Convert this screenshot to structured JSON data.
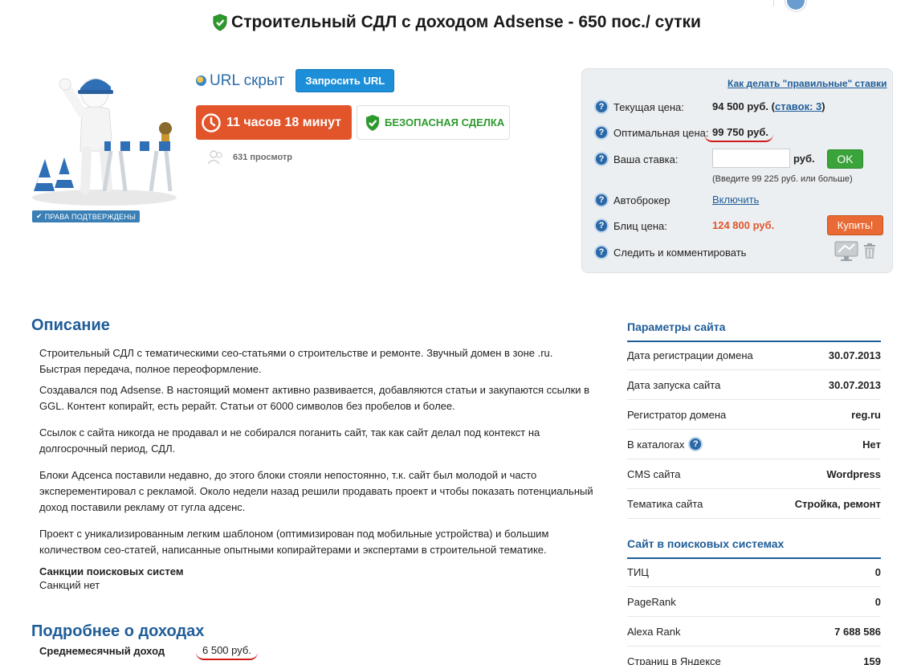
{
  "title": "Строительный СДЛ с доходом Adsense - 650 пос./ сутки",
  "rights_badge": "ПРАВА ПОДТВЕРЖДЕНЫ",
  "url_hidden": "URL скрыт",
  "request_url_button": "Запросить URL",
  "timer": "11 часов 18 минут",
  "safe_deal": "БЕЗОПАСНАЯ СДЕЛКА",
  "views": "631 просмотр",
  "bid": {
    "how_link": "Как делать \"правильные\" ставки",
    "current_label": "Текущая цена:",
    "current_value": "94 500 руб.",
    "current_bids_prefix": "(",
    "current_bids_link": "ставок: 3",
    "current_bids_suffix": ")",
    "optimal_label": "Оптимальная цена:",
    "optimal_value": "99 750 руб.",
    "your_bid_label": "Ваша ставка:",
    "your_bid_value": "",
    "rub": "руб.",
    "ok": "OK",
    "hint": "(Введите 99 225 руб. или больше)",
    "autobroker_label": "Автоброкер",
    "autobroker_link": "Включить",
    "blitz_label": "Блиц цена:",
    "blitz_value": "124 800 руб.",
    "buy": "Купить!",
    "follow_label": "Следить и комментировать"
  },
  "description": {
    "heading": "Описание",
    "p1": "Строительный СДЛ с тематическими сео-статьями о строительстве и ремонте. Звучный домен в зоне .ru. Быстрая передача, полное переоформление.",
    "p2": "Создавался под Adsense. В настоящий момент активно развивается, добавляются статьи и закупаются ссылки в GGL. Контент копирайт, есть рерайт. Статьи от 6000 символов без пробелов и более.",
    "p3": "Ссылок с сайта никогда не продавал и не собирался поганить сайт, так как сайт делал под контекст на долгосрочный период, СДЛ.",
    "p4": "Блоки Адсенса поставили недавно, до этого блоки стояли непостоянно, т.к. сайт был молодой и часто эксперементировал с рекламой. Около недели назад решили продавать проект и чтобы показать потенциальный доход поставили рекламу от гугла адсенс.",
    "p5": "Проект с уникализированным легким шаблоном (оптимизирован под мобильные устройства) и большим количеством сео-статей, написанные опытными копирайтерами и экспертами в строительной тематике.",
    "sanctions_label": "Санкции поисковых систем",
    "sanctions_value": "Санкций нет"
  },
  "income": {
    "heading": "Подробнее о доходах",
    "monthly_label": "Среднемесячный доход",
    "monthly_value": "6 500 руб."
  },
  "site_params": {
    "heading": "Параметры сайта",
    "rows": [
      {
        "label": "Дата регистрации домена",
        "value": "30.07.2013"
      },
      {
        "label": "Дата запуска сайта",
        "value": "30.07.2013"
      },
      {
        "label": "Регистратор домена",
        "value": "reg.ru"
      },
      {
        "label": "В каталогах",
        "value": "Нет"
      },
      {
        "label": "CMS сайта",
        "value": "Wordpress"
      },
      {
        "label": "Тематика сайта",
        "value": "Стройка, ремонт"
      }
    ]
  },
  "search_engines": {
    "heading": "Сайт в поисковых системах",
    "rows": [
      {
        "label": "ТИЦ",
        "value": "0"
      },
      {
        "label": "PageRank",
        "value": "0"
      },
      {
        "label": "Alexa Rank",
        "value": "7 688 586"
      },
      {
        "label": "Страниц в Яндексе",
        "value": "159"
      }
    ]
  },
  "colors": {
    "accent_blue": "#1f5d99",
    "timer_orange": "#e2542a",
    "safe_green": "#2e9a2e",
    "underline_red": "#d01a1a"
  }
}
